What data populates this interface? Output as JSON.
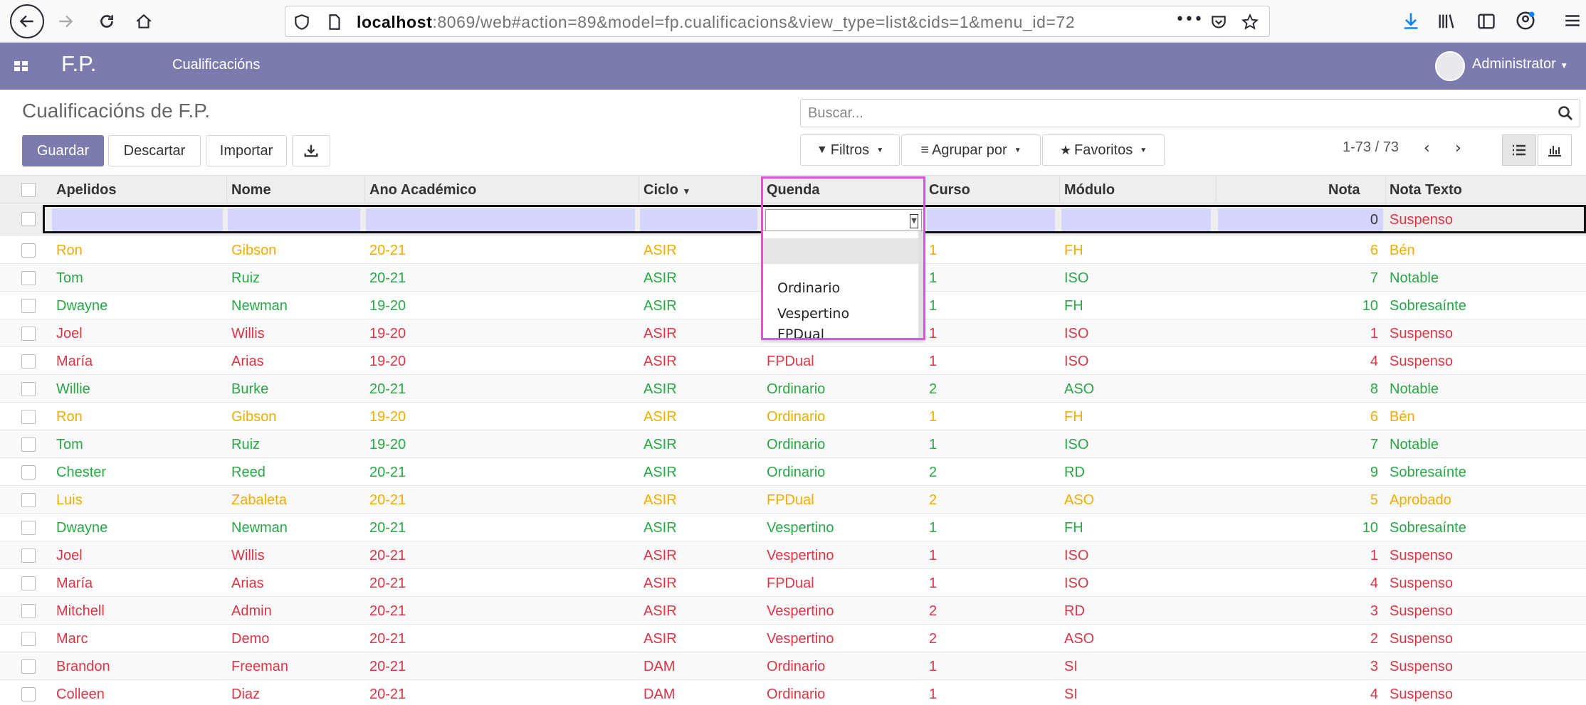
{
  "browser": {
    "url_host": "localhost",
    "url_rest": ":8069/web#action=89&model=fp.cualificacions&view_type=list&cids=1&menu_id=72"
  },
  "app": {
    "brand": "F.P.",
    "menu": "Cualificacións",
    "user": "Administrator"
  },
  "control_panel": {
    "title": "Cualificacións de F.P.",
    "save": "Guardar",
    "discard": "Descartar",
    "import": "Importar",
    "search_placeholder": "Buscar...",
    "filters": "Filtros",
    "group_by": "Agrupar por",
    "favorites": "Favoritos",
    "pager": "1-73 / 73"
  },
  "table": {
    "headers": [
      "Apelidos",
      "Nome",
      "Ano Académico",
      "Ciclo",
      "Quenda",
      "Curso",
      "Módulo",
      "Nota",
      "Nota Texto"
    ],
    "edit_row": {
      "nota": "0",
      "nota_texto": "Suspenso"
    },
    "rows": [
      {
        "apelidos": "Ron",
        "nome": "Gibson",
        "ano": "20-21",
        "ciclo": "ASIR",
        "quenda": "",
        "curso": "1",
        "modulo": "FH",
        "nota": "6",
        "texto": "Bén",
        "color": "orange"
      },
      {
        "apelidos": "Tom",
        "nome": "Ruiz",
        "ano": "20-21",
        "ciclo": "ASIR",
        "quenda": "",
        "curso": "1",
        "modulo": "ISO",
        "nota": "7",
        "texto": "Notable",
        "color": "green"
      },
      {
        "apelidos": "Dwayne",
        "nome": "Newman",
        "ano": "19-20",
        "ciclo": "ASIR",
        "quenda": "",
        "curso": "1",
        "modulo": "FH",
        "nota": "10",
        "texto": "Sobresaínte",
        "color": "green"
      },
      {
        "apelidos": "Joel",
        "nome": "Willis",
        "ano": "19-20",
        "ciclo": "ASIR",
        "quenda": "",
        "curso": "1",
        "modulo": "ISO",
        "nota": "1",
        "texto": "Suspenso",
        "color": "red"
      },
      {
        "apelidos": "María",
        "nome": "Arias",
        "ano": "19-20",
        "ciclo": "ASIR",
        "quenda": "FPDual",
        "curso": "1",
        "modulo": "ISO",
        "nota": "4",
        "texto": "Suspenso",
        "color": "red"
      },
      {
        "apelidos": "Willie",
        "nome": "Burke",
        "ano": "20-21",
        "ciclo": "ASIR",
        "quenda": "Ordinario",
        "curso": "2",
        "modulo": "ASO",
        "nota": "8",
        "texto": "Notable",
        "color": "green"
      },
      {
        "apelidos": "Ron",
        "nome": "Gibson",
        "ano": "19-20",
        "ciclo": "ASIR",
        "quenda": "Ordinario",
        "curso": "1",
        "modulo": "FH",
        "nota": "6",
        "texto": "Bén",
        "color": "orange"
      },
      {
        "apelidos": "Tom",
        "nome": "Ruiz",
        "ano": "19-20",
        "ciclo": "ASIR",
        "quenda": "Ordinario",
        "curso": "1",
        "modulo": "ISO",
        "nota": "7",
        "texto": "Notable",
        "color": "green"
      },
      {
        "apelidos": "Chester",
        "nome": "Reed",
        "ano": "20-21",
        "ciclo": "ASIR",
        "quenda": "Ordinario",
        "curso": "2",
        "modulo": "RD",
        "nota": "9",
        "texto": "Sobresaínte",
        "color": "green"
      },
      {
        "apelidos": "Luis",
        "nome": "Zabaleta",
        "ano": "20-21",
        "ciclo": "ASIR",
        "quenda": "FPDual",
        "curso": "2",
        "modulo": "ASO",
        "nota": "5",
        "texto": "Aprobado",
        "color": "orange"
      },
      {
        "apelidos": "Dwayne",
        "nome": "Newman",
        "ano": "20-21",
        "ciclo": "ASIR",
        "quenda": "Vespertino",
        "curso": "1",
        "modulo": "FH",
        "nota": "10",
        "texto": "Sobresaínte",
        "color": "green"
      },
      {
        "apelidos": "Joel",
        "nome": "Willis",
        "ano": "20-21",
        "ciclo": "ASIR",
        "quenda": "Vespertino",
        "curso": "1",
        "modulo": "ISO",
        "nota": "1",
        "texto": "Suspenso",
        "color": "red"
      },
      {
        "apelidos": "María",
        "nome": "Arias",
        "ano": "20-21",
        "ciclo": "ASIR",
        "quenda": "FPDual",
        "curso": "1",
        "modulo": "ISO",
        "nota": "4",
        "texto": "Suspenso",
        "color": "red"
      },
      {
        "apelidos": "Mitchell",
        "nome": "Admin",
        "ano": "20-21",
        "ciclo": "ASIR",
        "quenda": "Vespertino",
        "curso": "2",
        "modulo": "RD",
        "nota": "3",
        "texto": "Suspenso",
        "color": "red"
      },
      {
        "apelidos": "Marc",
        "nome": "Demo",
        "ano": "20-21",
        "ciclo": "ASIR",
        "quenda": "Vespertino",
        "curso": "2",
        "modulo": "ASO",
        "nota": "2",
        "texto": "Suspenso",
        "color": "red"
      },
      {
        "apelidos": "Brandon",
        "nome": "Freeman",
        "ano": "20-21",
        "ciclo": "DAM",
        "quenda": "Ordinario",
        "curso": "1",
        "modulo": "SI",
        "nota": "3",
        "texto": "Suspenso",
        "color": "red"
      },
      {
        "apelidos": "Colleen",
        "nome": "Diaz",
        "ano": "20-21",
        "ciclo": "DAM",
        "quenda": "Ordinario",
        "curso": "1",
        "modulo": "SI",
        "nota": "4",
        "texto": "Suspenso",
        "color": "red"
      }
    ]
  },
  "dropdown": {
    "options": [
      "",
      "Ordinario",
      "Vespertino",
      "FPDual"
    ]
  },
  "colors": {
    "brand": "#7c7bad",
    "green": "#28a745",
    "red": "#dc3545",
    "orange": "#f0ad00",
    "highlight": "#e84fd9"
  }
}
